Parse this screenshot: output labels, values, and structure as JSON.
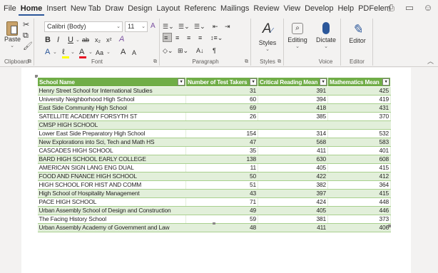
{
  "menu": {
    "items": [
      "File",
      "Home",
      "Insert",
      "New Tab",
      "Draw",
      "Design",
      "Layout",
      "Referenc",
      "Mailings",
      "Review",
      "View",
      "Develop",
      "Help",
      "PDFelem"
    ],
    "active": "Home"
  },
  "ribbon": {
    "clipboard": {
      "paste_label": "Paste",
      "group_label": "Clipboard"
    },
    "font": {
      "font_name": "Calibri (Body)",
      "font_size": "11",
      "group_label": "Font",
      "bold": "B",
      "italic": "I",
      "underline": "U",
      "strike": "ab",
      "subscript": "x₂",
      "superscript": "x²",
      "text_effects": "A",
      "highlight": "ℓ",
      "font_color": "A",
      "change_case": "Aa",
      "grow": "A",
      "shrink": "A"
    },
    "paragraph": {
      "group_label": "Paragraph",
      "pilcrow": "¶",
      "sort": "A↓"
    },
    "styles": {
      "label": "Styles",
      "group_label": "Styles"
    },
    "editing": {
      "label": "Editing"
    },
    "voice": {
      "label": "Dictate",
      "group_label": "Voice"
    },
    "editor": {
      "label": "Editor",
      "group_label": "Editor"
    }
  },
  "table": {
    "headers": [
      "School Name",
      "Number of Test Takers",
      "Critical Reading Mean",
      "Mathematics Mean"
    ],
    "rows": [
      [
        "Henry Street School for International Studies",
        "31",
        "391",
        "425"
      ],
      [
        "University Neighborhood High School",
        "60",
        "394",
        "419"
      ],
      [
        "East Side Community High School",
        "69",
        "418",
        "431"
      ],
      [
        "SATELLITE ACADEMY FORSYTH ST",
        "26",
        "385",
        "370"
      ],
      [
        "CMSP HIGH SCHOOL",
        "",
        "",
        ""
      ],
      [
        "Lower East Side Preparatory High School",
        "154",
        "314",
        "532"
      ],
      [
        "New Explorations into Sci, Tech and Math HS",
        "47",
        "568",
        "583"
      ],
      [
        "CASCADES HIGH SCHOOL",
        "35",
        "411",
        "401"
      ],
      [
        "BARD HIGH SCHOOL EARLY COLLEGE",
        "138",
        "630",
        "608"
      ],
      [
        "AMERICAN SIGN LANG ENG DUAL",
        "11",
        "405",
        "415"
      ],
      [
        "FOOD AND FNANCE HIGH SCHOOL",
        "50",
        "422",
        "412"
      ],
      [
        "HIGH SCHOOL FOR HIST AND COMM",
        "51",
        "382",
        "364"
      ],
      [
        "High School of Hospitality Management",
        "43",
        "397",
        "415"
      ],
      [
        "PACE HIGH SCHOOL",
        "71",
        "424",
        "448"
      ],
      [
        "Urban Assembly School of Design and Construction",
        "49",
        "405",
        "446"
      ],
      [
        "The Facing History School",
        "59",
        "381",
        "373"
      ],
      [
        "Urban Assembly Academy of Government and Law",
        "48",
        "411",
        "406"
      ]
    ]
  },
  "colors": {
    "header_bg": "#70ad47",
    "band_bg": "#e2efda",
    "accent": "#2b579a"
  }
}
